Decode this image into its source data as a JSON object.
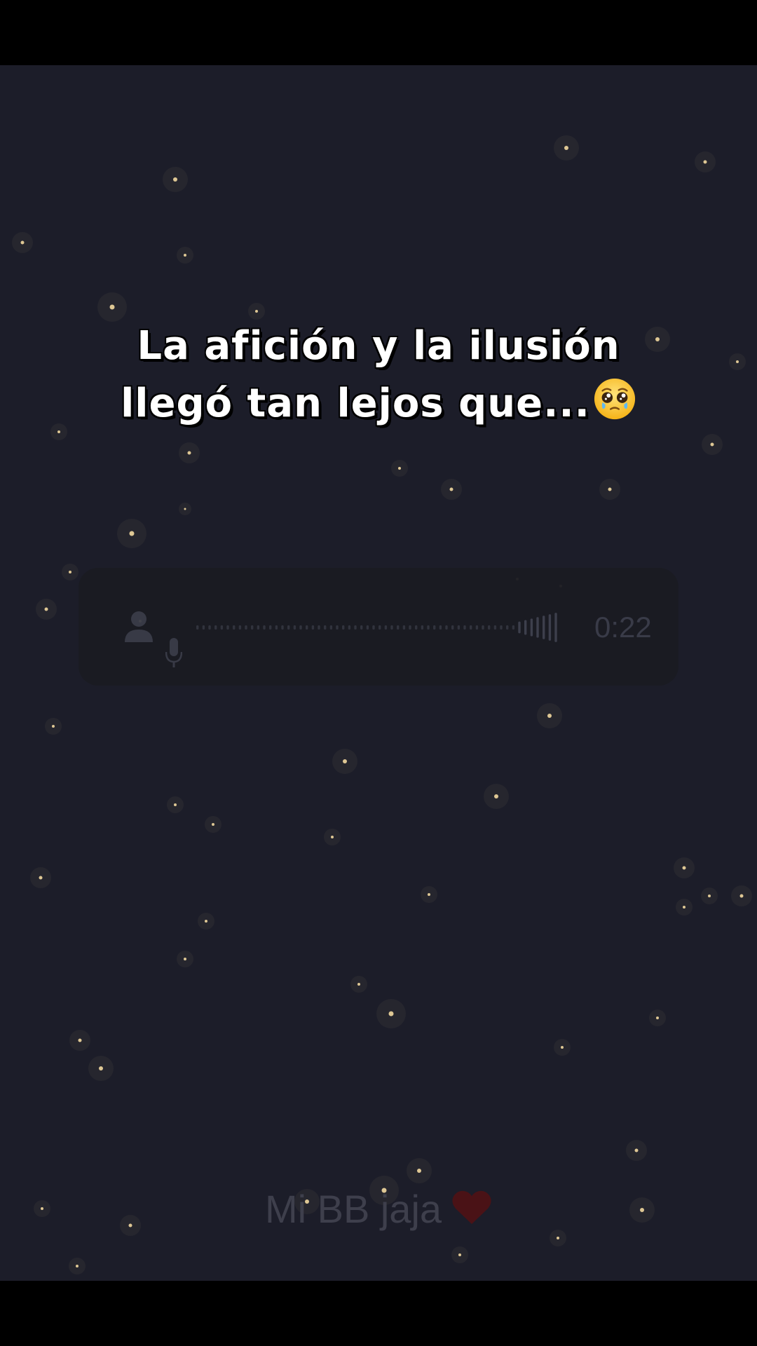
{
  "caption": {
    "line1": "La afición y la ilusión",
    "line2": "llegó tan lejos que...",
    "emoji": "pleading-face-with-tear"
  },
  "voice_message": {
    "duration": "0:22",
    "avatar_icon": "person-icon",
    "mic_icon": "microphone-icon",
    "played_fraction": 0.88
  },
  "footer": {
    "text": "Mi BB jaja",
    "icon": "heart-icon"
  },
  "colors": {
    "background": "#1c1d29",
    "star": "#f3d9a0",
    "caption_text": "#ffffff",
    "muted_text": "#3e3f4c",
    "heart": "#4a1216"
  }
}
